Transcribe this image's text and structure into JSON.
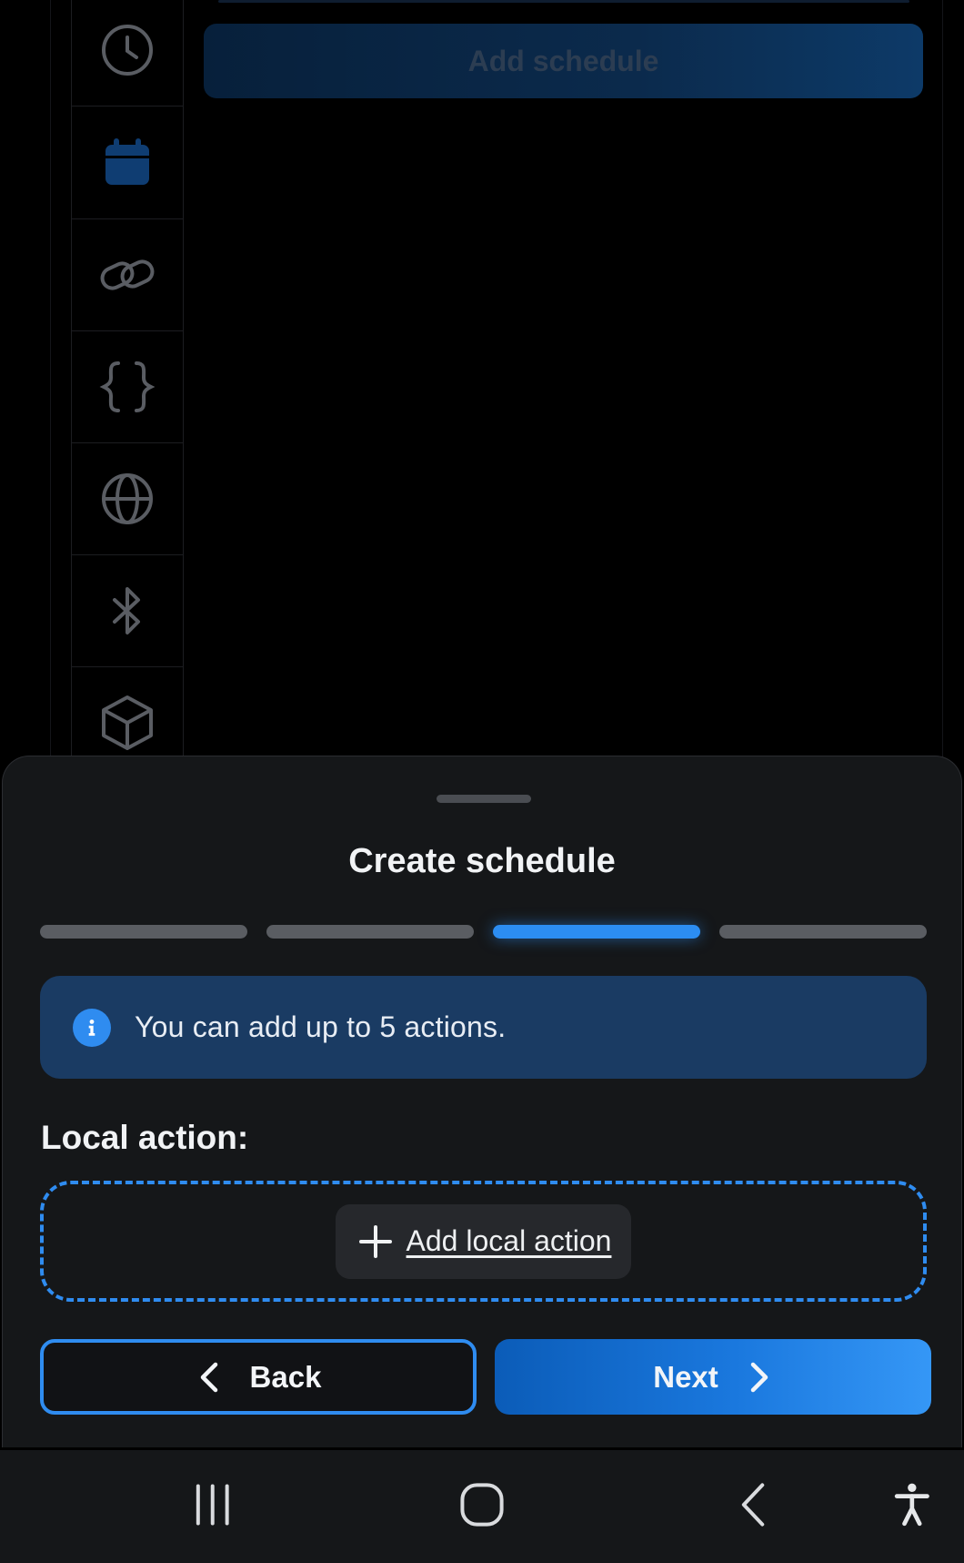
{
  "background": {
    "add_schedule_label": "Add schedule",
    "sidebar_icons": [
      "clock-icon",
      "calendar-icon",
      "link-icon",
      "braces-icon",
      "globe-icon",
      "bluetooth-icon",
      "cube-icon"
    ],
    "selected_icon": "calendar-icon"
  },
  "sheet": {
    "title": "Create schedule",
    "steps": {
      "total": 4,
      "current": 3
    },
    "info": {
      "icon": "info-icon",
      "text": "You can add up to 5 actions."
    },
    "local_action_label": "Local action:",
    "add_local_action_label": "Add local action",
    "back_label": "Back",
    "next_label": "Next"
  },
  "navbar": {
    "icons": [
      "recents-icon",
      "home-icon",
      "back-icon",
      "accessibility-icon"
    ]
  },
  "colors": {
    "accent": "#2f8cf0",
    "banner": "#1a3b63",
    "sheet_bg": "#151719",
    "step_inactive": "#5a5d62"
  }
}
